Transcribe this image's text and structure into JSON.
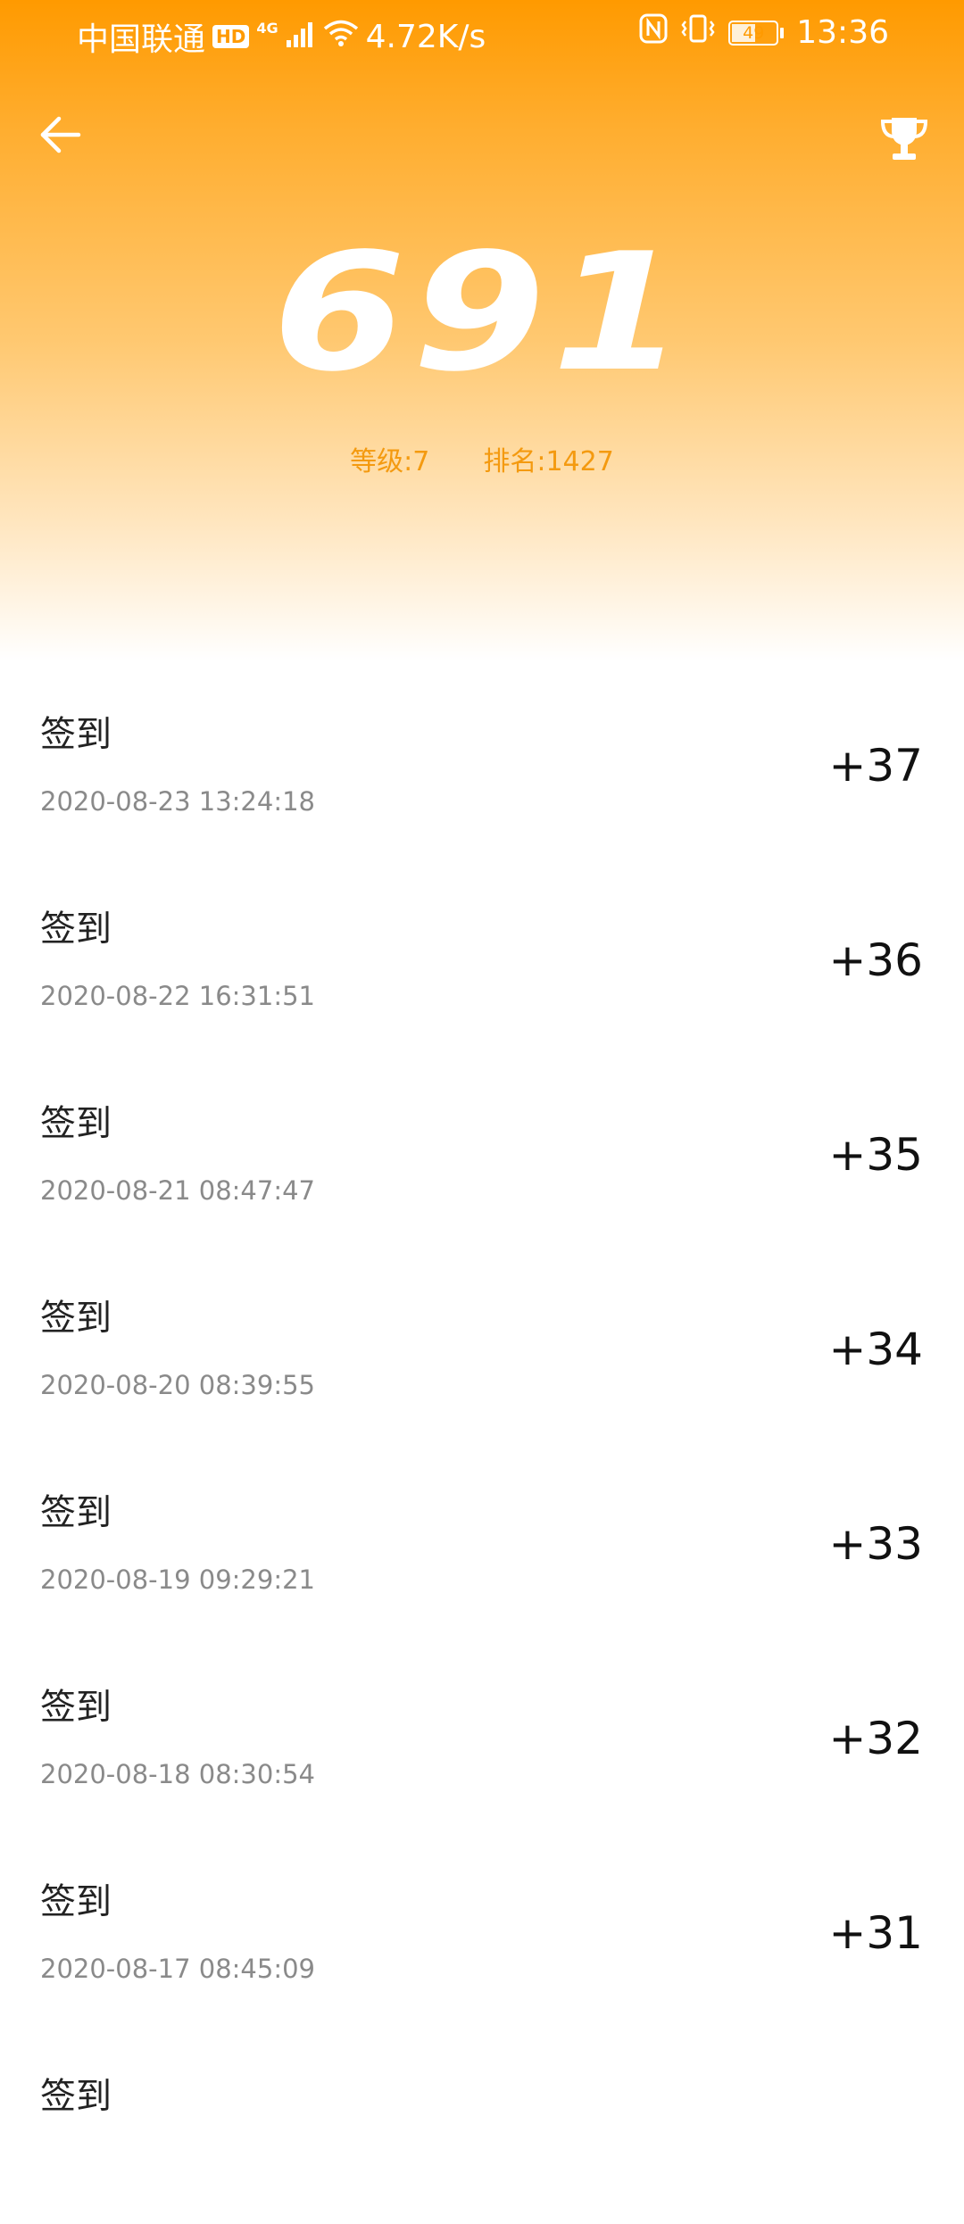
{
  "status_bar": {
    "carrier": "中国联通",
    "hd": "HD",
    "network_type": "4G",
    "speed": "4.72K/s",
    "battery": "49",
    "time": "13:36"
  },
  "header": {
    "score": "691",
    "level": "等级:7",
    "rank": "排名:1427"
  },
  "records": [
    {
      "title": "签到",
      "time": "2020-08-23 13:24:18",
      "points": "+37"
    },
    {
      "title": "签到",
      "time": "2020-08-22 16:31:51",
      "points": "+36"
    },
    {
      "title": "签到",
      "time": "2020-08-21 08:47:47",
      "points": "+35"
    },
    {
      "title": "签到",
      "time": "2020-08-20 08:39:55",
      "points": "+34"
    },
    {
      "title": "签到",
      "time": "2020-08-19 09:29:21",
      "points": "+33"
    },
    {
      "title": "签到",
      "time": "2020-08-18 08:30:54",
      "points": "+32"
    },
    {
      "title": "签到",
      "time": "2020-08-17 08:45:09",
      "points": "+31"
    },
    {
      "title": "签到",
      "time": "",
      "points": ""
    }
  ],
  "colors": {
    "header_top": "#ff9a00",
    "accent_text": "#f49a10",
    "timestamp": "#8a8a8a"
  },
  "icons": [
    "back-arrow-icon",
    "trophy-icon",
    "signal-icon",
    "wifi-icon",
    "nfc-icon",
    "vibrate-icon",
    "battery-icon"
  ]
}
